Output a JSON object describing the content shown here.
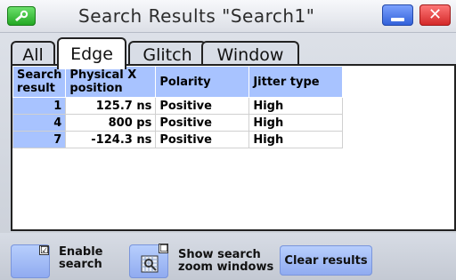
{
  "window": {
    "title": "Search Results \"Search1\"",
    "icons": {
      "app": "wrench-icon",
      "minimize": "minimize-icon",
      "close": "close-icon"
    },
    "close_glyph": "✕"
  },
  "tabs": [
    {
      "label": "All",
      "active": false
    },
    {
      "label": "Edge",
      "active": true
    },
    {
      "label": "Glitch",
      "active": false
    },
    {
      "label": "Window",
      "active": false
    }
  ],
  "table": {
    "headers": [
      {
        "line1": "Search",
        "line2": "result"
      },
      {
        "line1": "Physical X",
        "line2": "position"
      },
      {
        "line1": "Polarity",
        "line2": ""
      },
      {
        "line1": "Jitter type",
        "line2": ""
      }
    ],
    "rows": [
      {
        "search_result": "1",
        "physical_x_position": "125.7 ns",
        "polarity": "Positive",
        "jitter_type": "High"
      },
      {
        "search_result": "4",
        "physical_x_position": "800 ps",
        "polarity": "Positive",
        "jitter_type": "High"
      },
      {
        "search_result": "7",
        "physical_x_position": "-124.3 ns",
        "polarity": "Positive",
        "jitter_type": "High"
      }
    ]
  },
  "controls": {
    "enable_search": {
      "label_line1": "Enable",
      "label_line2": "search",
      "checked": true,
      "check_glyph": "☑"
    },
    "show_zoom": {
      "label_line1": "Show search",
      "label_line2": "zoom windows",
      "checked": false,
      "check_glyph": "☐"
    },
    "clear_results_label": "Clear results"
  },
  "colors": {
    "header_blue": "#a8c3ff",
    "title_bar": "#dcdfe6",
    "minimize_blue": "#2f5fd8",
    "close_red": "#d22626",
    "app_icon_green": "#20a520"
  }
}
